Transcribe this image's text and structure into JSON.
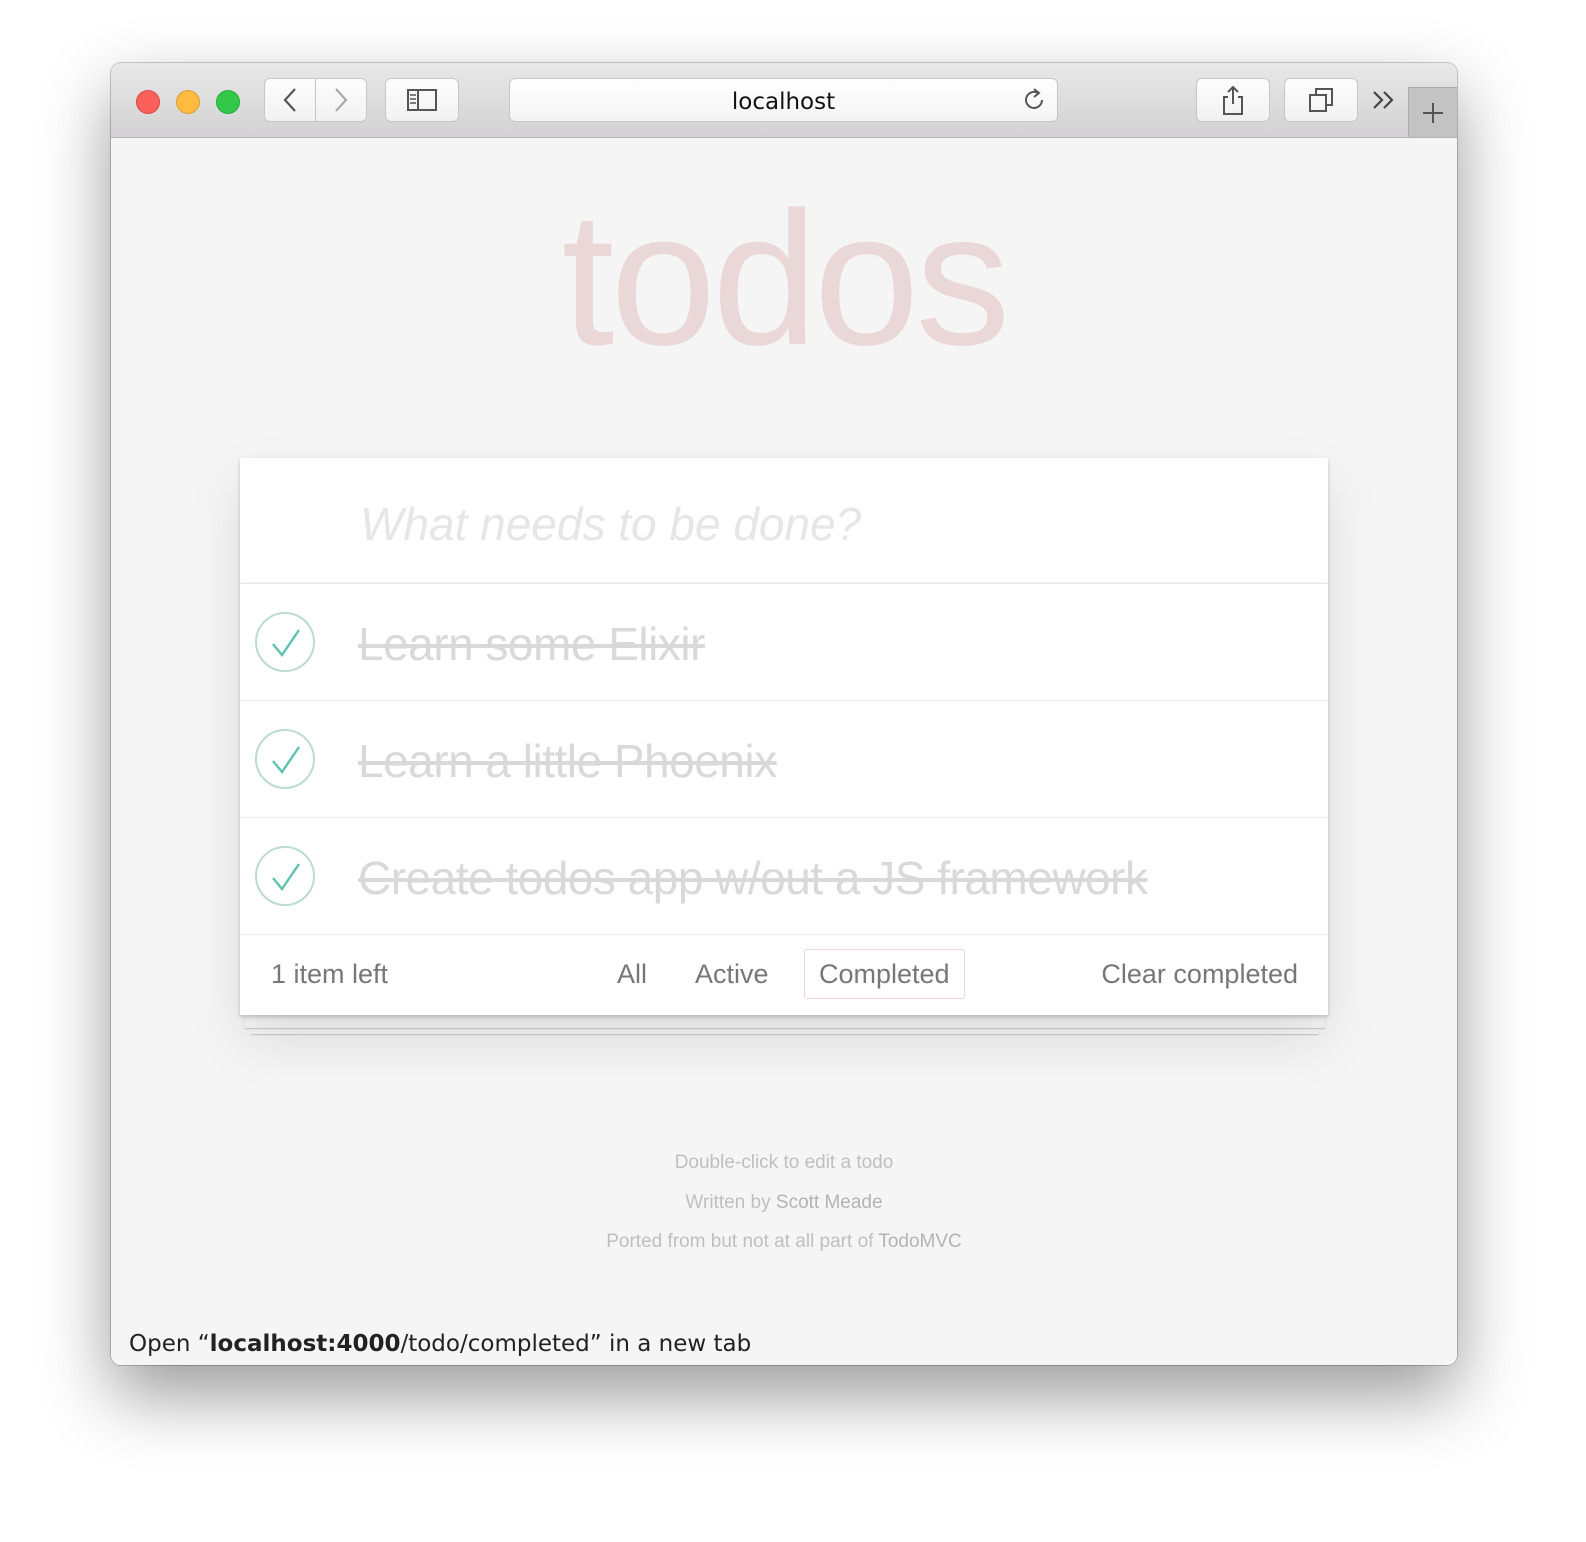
{
  "browser": {
    "url_display": "localhost",
    "status_bar": {
      "prefix": "Open “",
      "host": "localhost:4000",
      "path": "/todo/completed",
      "suffix": "” in a new tab"
    },
    "icons": {
      "back": "chevron-left-icon",
      "forward": "chevron-right-icon",
      "sidebar": "sidebar-icon",
      "reload": "reload-icon",
      "share": "share-icon",
      "tabs": "tabs-overview-icon",
      "overflow": "double-chevron-right-icon",
      "new_tab": "plus-icon"
    },
    "traffic_lights": {
      "close": "#fc605b",
      "minimize": "#fdbc40",
      "zoom": "#34c84a"
    }
  },
  "app": {
    "title": "todos",
    "new_todo_placeholder": "What needs to be done?",
    "todos": [
      {
        "label": "Learn some Elixir",
        "completed": true
      },
      {
        "label": "Learn a little Phoenix",
        "completed": true
      },
      {
        "label": "Create todos app w/out a JS framework",
        "completed": true
      }
    ],
    "footer": {
      "count": "1 item left",
      "filters": [
        "All",
        "Active",
        "Completed"
      ],
      "selected_filter": "Completed",
      "clear_completed": "Clear completed"
    },
    "info": {
      "line1": "Double-click to edit a todo",
      "line2_prefix": "Written by ",
      "line2_link": "Scott Meade",
      "line3_prefix": "Ported from but not at all part of ",
      "line3_link": "TodoMVC"
    },
    "colors": {
      "title": "rgba(175,47,47,0.15)",
      "checkmark": "#5dc2af",
      "completed_text": "#d9d9d9"
    }
  }
}
